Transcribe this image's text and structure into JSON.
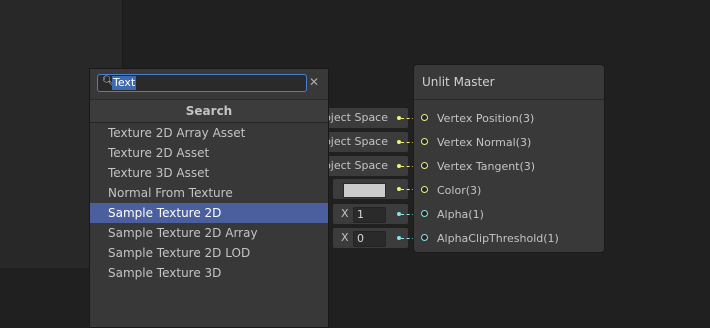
{
  "search_popup": {
    "query": "Text",
    "header": "Search",
    "results": [
      {
        "label": "Texture 2D Array Asset"
      },
      {
        "label": "Texture 2D Asset"
      },
      {
        "label": "Texture 3D Asset"
      },
      {
        "label": "Normal From Texture"
      },
      {
        "label": "Sample Texture 2D"
      },
      {
        "label": "Sample Texture 2D Array"
      },
      {
        "label": "Sample Texture 2D LOD"
      },
      {
        "label": "Sample Texture 3D"
      }
    ],
    "selected_index": 4
  },
  "inputs": {
    "space_labels": [
      "Object Space",
      "Object Space",
      "Object Space"
    ],
    "alpha": {
      "axis": "X",
      "value": "1"
    },
    "alpha_clip": {
      "axis": "X",
      "value": "0"
    },
    "color_swatch": "#cccccc"
  },
  "master_node": {
    "title": "Unlit Master",
    "ports": [
      {
        "label": "Vertex Position(3)",
        "color": "#f1f17a"
      },
      {
        "label": "Vertex Normal(3)",
        "color": "#f1f17a"
      },
      {
        "label": "Vertex Tangent(3)",
        "color": "#f1f17a"
      },
      {
        "label": "Color(3)",
        "color": "#f1f17a"
      },
      {
        "label": "Alpha(1)",
        "color": "#84e4e7"
      },
      {
        "label": "AlphaClipThreshold(1)",
        "color": "#84e4e7"
      }
    ]
  }
}
